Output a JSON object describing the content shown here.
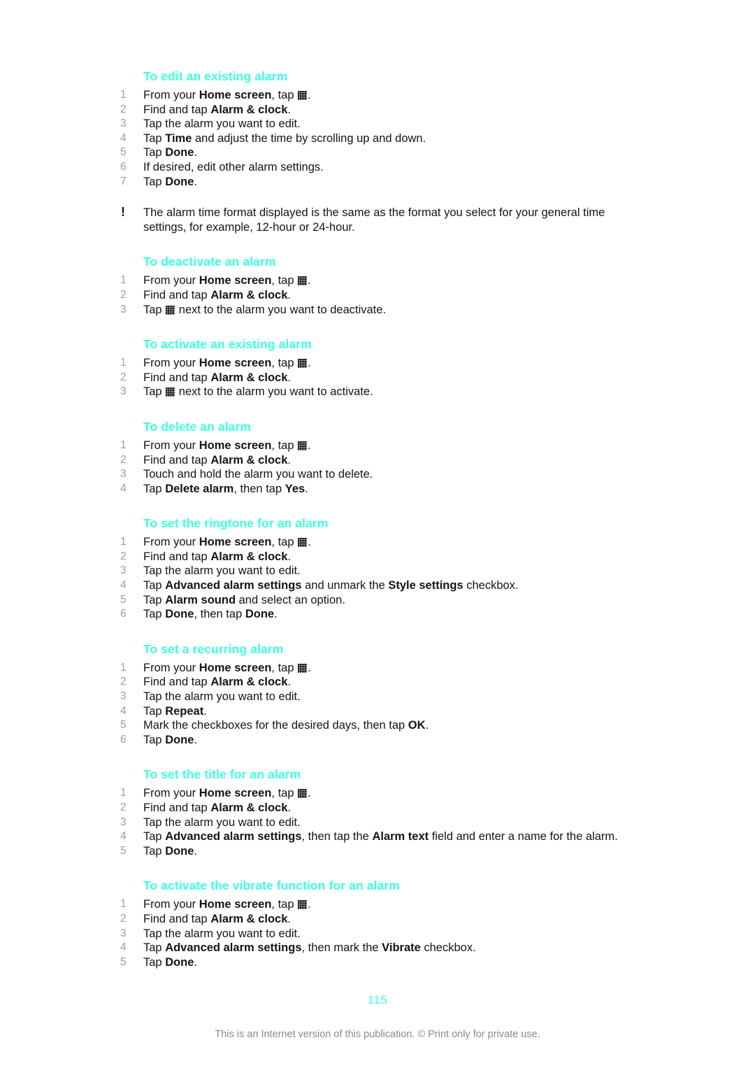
{
  "document": {
    "page_number": "115",
    "footer_note": "This is an Internet version of this publication. © Print only for private use.",
    "heading_color": "#3cffe0",
    "number_color": "#9c9c9c",
    "body_color": "#141414",
    "footer_color": "#8a8a8a"
  },
  "note": {
    "icon": "exclamation-icon",
    "icon_glyph": "!",
    "text": "The alarm time format displayed is the same as the format you select for your general time settings, for example, 12-hour or 24-hour."
  },
  "sections": [
    {
      "id": "edit-existing-alarm",
      "heading": "To edit an existing alarm",
      "steps": [
        {
          "num": "1",
          "parts": [
            {
              "t": "From your "
            },
            {
              "t": "Home screen",
              "b": true
            },
            {
              "t": ", tap "
            },
            {
              "icon": "app-drawer-grid-icon"
            },
            {
              "t": "."
            }
          ]
        },
        {
          "num": "2",
          "parts": [
            {
              "t": "Find and tap "
            },
            {
              "t": "Alarm & clock",
              "b": true
            },
            {
              "t": "."
            }
          ]
        },
        {
          "num": "3",
          "parts": [
            {
              "t": "Tap the alarm you want to edit."
            }
          ]
        },
        {
          "num": "4",
          "parts": [
            {
              "t": "Tap "
            },
            {
              "t": "Time",
              "b": true
            },
            {
              "t": " and adjust the time by scrolling up and down."
            }
          ]
        },
        {
          "num": "5",
          "parts": [
            {
              "t": "Tap "
            },
            {
              "t": "Done",
              "b": true
            },
            {
              "t": "."
            }
          ]
        },
        {
          "num": "6",
          "parts": [
            {
              "t": "If desired, edit other alarm settings."
            }
          ]
        },
        {
          "num": "7",
          "parts": [
            {
              "t": "Tap "
            },
            {
              "t": "Done",
              "b": true
            },
            {
              "t": "."
            }
          ]
        }
      ]
    },
    {
      "id": "deactivate-an-alarm",
      "heading": "To deactivate an alarm",
      "steps": [
        {
          "num": "1",
          "parts": [
            {
              "t": "From your "
            },
            {
              "t": "Home screen",
              "b": true
            },
            {
              "t": ", tap "
            },
            {
              "icon": "app-drawer-grid-icon"
            },
            {
              "t": "."
            }
          ]
        },
        {
          "num": "2",
          "parts": [
            {
              "t": "Find and tap "
            },
            {
              "t": "Alarm & clock",
              "b": true
            },
            {
              "t": "."
            }
          ]
        },
        {
          "num": "3",
          "parts": [
            {
              "t": "Tap "
            },
            {
              "icon": "app-drawer-grid-icon"
            },
            {
              "t": " next to the alarm you want to deactivate."
            }
          ]
        }
      ]
    },
    {
      "id": "activate-existing-alarm",
      "heading": "To activate an existing alarm",
      "steps": [
        {
          "num": "1",
          "parts": [
            {
              "t": "From your "
            },
            {
              "t": "Home screen",
              "b": true
            },
            {
              "t": ", tap "
            },
            {
              "icon": "app-drawer-grid-icon"
            },
            {
              "t": "."
            }
          ]
        },
        {
          "num": "2",
          "parts": [
            {
              "t": "Find and tap "
            },
            {
              "t": "Alarm & clock",
              "b": true
            },
            {
              "t": "."
            }
          ]
        },
        {
          "num": "3",
          "parts": [
            {
              "t": "Tap "
            },
            {
              "icon": "app-drawer-grid-icon"
            },
            {
              "t": " next to the alarm you want to activate."
            }
          ]
        }
      ]
    },
    {
      "id": "delete-an-alarm",
      "heading": "To delete an alarm",
      "steps": [
        {
          "num": "1",
          "parts": [
            {
              "t": "From your "
            },
            {
              "t": "Home screen",
              "b": true
            },
            {
              "t": ", tap "
            },
            {
              "icon": "app-drawer-grid-icon"
            },
            {
              "t": "."
            }
          ]
        },
        {
          "num": "2",
          "parts": [
            {
              "t": "Find and tap "
            },
            {
              "t": "Alarm & clock",
              "b": true
            },
            {
              "t": "."
            }
          ]
        },
        {
          "num": "3",
          "parts": [
            {
              "t": "Touch and hold the alarm you want to delete."
            }
          ]
        },
        {
          "num": "4",
          "parts": [
            {
              "t": "Tap "
            },
            {
              "t": "Delete alarm",
              "b": true
            },
            {
              "t": ", then tap "
            },
            {
              "t": "Yes",
              "b": true
            },
            {
              "t": "."
            }
          ]
        }
      ]
    },
    {
      "id": "set-ringtone-for-alarm",
      "heading": "To set the ringtone for an alarm",
      "steps": [
        {
          "num": "1",
          "parts": [
            {
              "t": "From your "
            },
            {
              "t": "Home screen",
              "b": true
            },
            {
              "t": ", tap "
            },
            {
              "icon": "app-drawer-grid-icon"
            },
            {
              "t": "."
            }
          ]
        },
        {
          "num": "2",
          "parts": [
            {
              "t": "Find and tap "
            },
            {
              "t": "Alarm & clock",
              "b": true
            },
            {
              "t": "."
            }
          ]
        },
        {
          "num": "3",
          "parts": [
            {
              "t": "Tap the alarm you want to edit."
            }
          ]
        },
        {
          "num": "4",
          "parts": [
            {
              "t": "Tap "
            },
            {
              "t": "Advanced alarm settings",
              "b": true
            },
            {
              "t": " and unmark the "
            },
            {
              "t": "Style settings",
              "b": true
            },
            {
              "t": " checkbox."
            }
          ]
        },
        {
          "num": "5",
          "parts": [
            {
              "t": "Tap "
            },
            {
              "t": "Alarm sound",
              "b": true
            },
            {
              "t": " and select an option."
            }
          ]
        },
        {
          "num": "6",
          "parts": [
            {
              "t": "Tap "
            },
            {
              "t": "Done",
              "b": true
            },
            {
              "t": ", then tap "
            },
            {
              "t": "Done",
              "b": true
            },
            {
              "t": "."
            }
          ]
        }
      ]
    },
    {
      "id": "set-recurring-alarm",
      "heading": "To set a recurring alarm",
      "steps": [
        {
          "num": "1",
          "parts": [
            {
              "t": "From your "
            },
            {
              "t": "Home screen",
              "b": true
            },
            {
              "t": ", tap "
            },
            {
              "icon": "app-drawer-grid-icon"
            },
            {
              "t": "."
            }
          ]
        },
        {
          "num": "2",
          "parts": [
            {
              "t": "Find and tap "
            },
            {
              "t": "Alarm & clock",
              "b": true
            },
            {
              "t": "."
            }
          ]
        },
        {
          "num": "3",
          "parts": [
            {
              "t": "Tap the alarm you want to edit."
            }
          ]
        },
        {
          "num": "4",
          "parts": [
            {
              "t": "Tap "
            },
            {
              "t": "Repeat",
              "b": true
            },
            {
              "t": "."
            }
          ]
        },
        {
          "num": "5",
          "parts": [
            {
              "t": "Mark the checkboxes for the desired days, then tap "
            },
            {
              "t": "OK",
              "b": true
            },
            {
              "t": "."
            }
          ]
        },
        {
          "num": "6",
          "parts": [
            {
              "t": "Tap "
            },
            {
              "t": "Done",
              "b": true
            },
            {
              "t": "."
            }
          ]
        }
      ]
    },
    {
      "id": "set-title-for-alarm",
      "heading": "To set the title for an alarm",
      "steps": [
        {
          "num": "1",
          "parts": [
            {
              "t": "From your "
            },
            {
              "t": "Home screen",
              "b": true
            },
            {
              "t": ", tap "
            },
            {
              "icon": "app-drawer-grid-icon"
            },
            {
              "t": "."
            }
          ]
        },
        {
          "num": "2",
          "parts": [
            {
              "t": "Find and tap "
            },
            {
              "t": "Alarm & clock",
              "b": true
            },
            {
              "t": "."
            }
          ]
        },
        {
          "num": "3",
          "parts": [
            {
              "t": "Tap the alarm you want to edit."
            }
          ]
        },
        {
          "num": "4",
          "parts": [
            {
              "t": "Tap "
            },
            {
              "t": "Advanced alarm settings",
              "b": true
            },
            {
              "t": ", then tap the "
            },
            {
              "t": "Alarm text",
              "b": true
            },
            {
              "t": " field and enter a name for the alarm."
            }
          ]
        },
        {
          "num": "5",
          "parts": [
            {
              "t": "Tap "
            },
            {
              "t": "Done",
              "b": true
            },
            {
              "t": "."
            }
          ]
        }
      ]
    },
    {
      "id": "activate-vibrate-for-alarm",
      "heading": "To activate the vibrate function for an alarm",
      "steps": [
        {
          "num": "1",
          "parts": [
            {
              "t": "From your "
            },
            {
              "t": "Home screen",
              "b": true
            },
            {
              "t": ", tap "
            },
            {
              "icon": "app-drawer-grid-icon"
            },
            {
              "t": "."
            }
          ]
        },
        {
          "num": "2",
          "parts": [
            {
              "t": "Find and tap "
            },
            {
              "t": "Alarm & clock",
              "b": true
            },
            {
              "t": "."
            }
          ]
        },
        {
          "num": "3",
          "parts": [
            {
              "t": "Tap the alarm you want to edit."
            }
          ]
        },
        {
          "num": "4",
          "parts": [
            {
              "t": "Tap "
            },
            {
              "t": "Advanced alarm settings",
              "b": true
            },
            {
              "t": ", then mark the "
            },
            {
              "t": "Vibrate",
              "b": true
            },
            {
              "t": " checkbox."
            }
          ]
        },
        {
          "num": "5",
          "parts": [
            {
              "t": "Tap "
            },
            {
              "t": "Done",
              "b": true
            },
            {
              "t": "."
            }
          ]
        }
      ]
    }
  ]
}
